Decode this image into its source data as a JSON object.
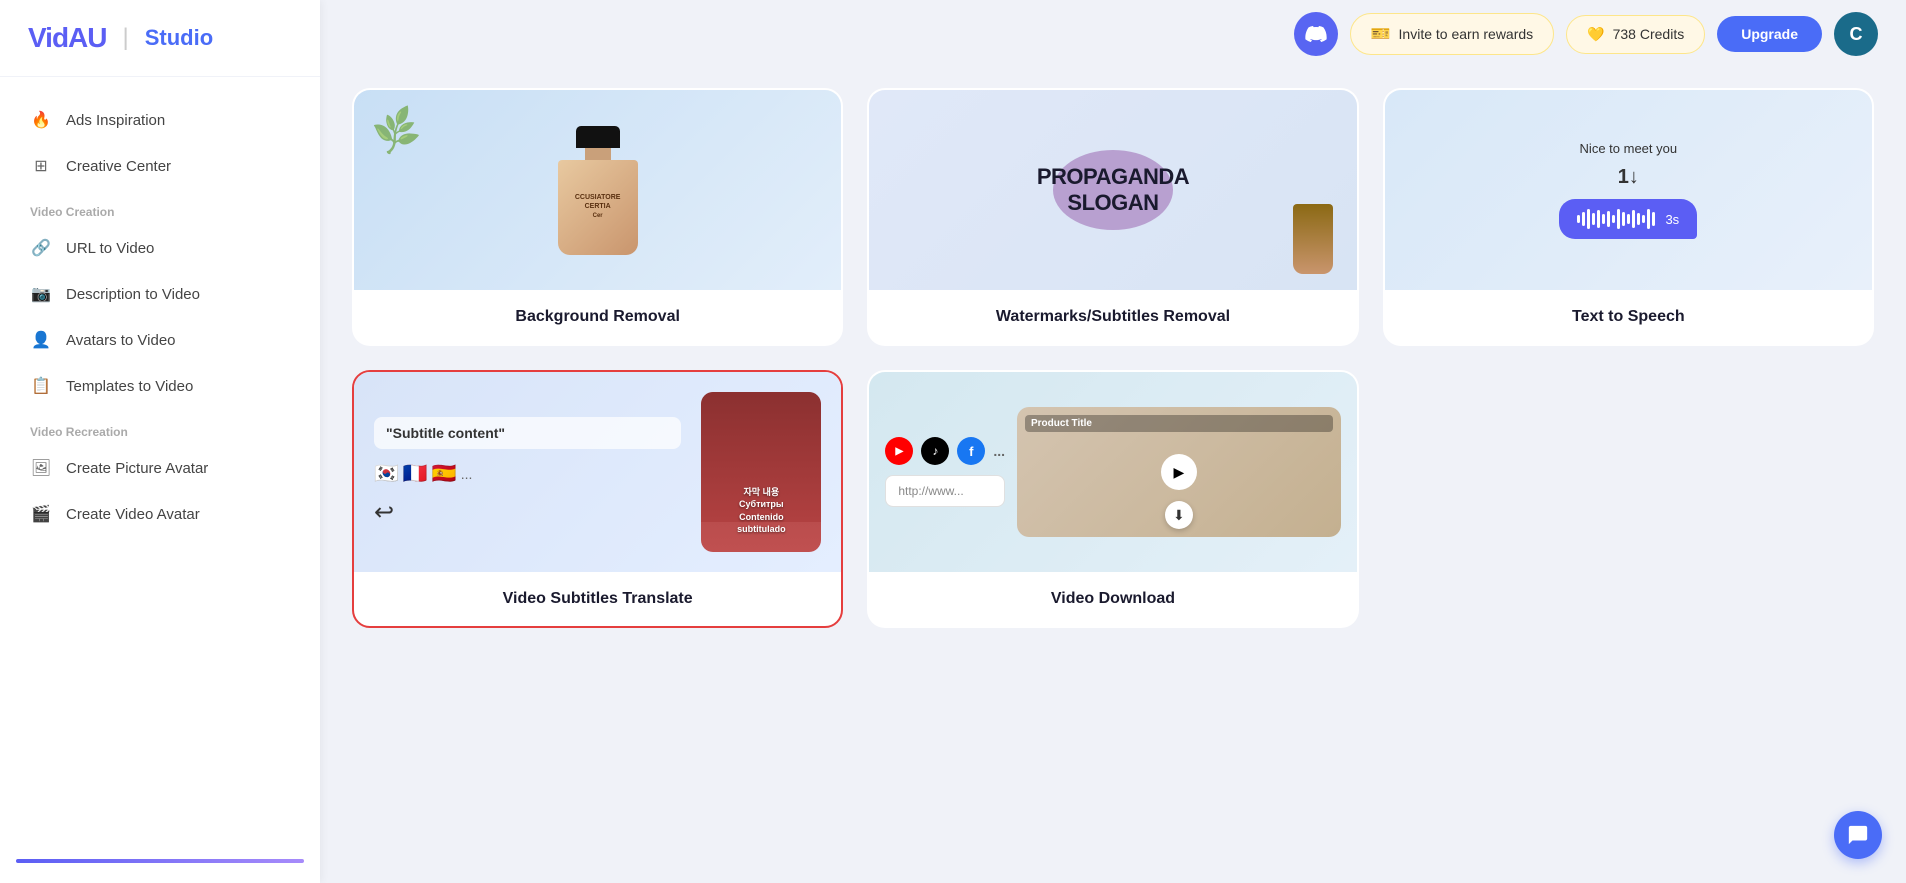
{
  "logo": {
    "brand": "VidAU",
    "divider": "|",
    "product": "Studio"
  },
  "sidebar": {
    "nav_items": [
      {
        "id": "ads-inspiration",
        "label": "Ads Inspiration",
        "icon": "🔥"
      },
      {
        "id": "creative-center",
        "label": "Creative Center",
        "icon": "⊞"
      }
    ],
    "sections": [
      {
        "label": "Video Creation",
        "items": [
          {
            "id": "url-to-video",
            "label": "URL to Video",
            "icon": "🔗"
          },
          {
            "id": "description-to-video",
            "label": "Description to Video",
            "icon": "📷"
          },
          {
            "id": "avatars-to-video",
            "label": "Avatars to Video",
            "icon": "👤"
          },
          {
            "id": "templates-to-video",
            "label": "Templates to Video",
            "icon": "📋"
          }
        ]
      },
      {
        "label": "Video Recreation",
        "items": [
          {
            "id": "create-picture-avatar",
            "label": "Create Picture Avatar",
            "icon": "🖼"
          },
          {
            "id": "create-video-avatar",
            "label": "Create Video Avatar",
            "icon": "🎬"
          }
        ]
      }
    ]
  },
  "header": {
    "discord_label": "D",
    "invite_label": "Invite to earn rewards",
    "credits_label": "738 Credits",
    "upgrade_label": "Upgrade",
    "user_initial": "C"
  },
  "cards": [
    {
      "id": "background-removal",
      "label": "Background Removal",
      "selected": false,
      "thumb_type": "bg_removal"
    },
    {
      "id": "watermarks-subtitles-removal",
      "label": "Watermarks/Subtitles Removal",
      "selected": false,
      "thumb_type": "watermarks"
    },
    {
      "id": "text-to-speech",
      "label": "Text to Speech",
      "selected": false,
      "thumb_type": "tts"
    },
    {
      "id": "video-subtitles-translate",
      "label": "Video Subtitles Translate",
      "selected": true,
      "thumb_type": "subtitles"
    },
    {
      "id": "video-download",
      "label": "Video Download",
      "selected": false,
      "thumb_type": "download"
    }
  ],
  "tts": {
    "top_text": "Nice to meet you",
    "timer": "3s",
    "number": "1↓"
  },
  "subtitles": {
    "quote": "\"Subtitle content\"",
    "lines": [
      "자막 내용",
      "Субтитры",
      "Contenido",
      "subtitulado"
    ]
  },
  "download": {
    "url_placeholder": "http://www...",
    "product_title": "Product Title",
    "more": "..."
  }
}
